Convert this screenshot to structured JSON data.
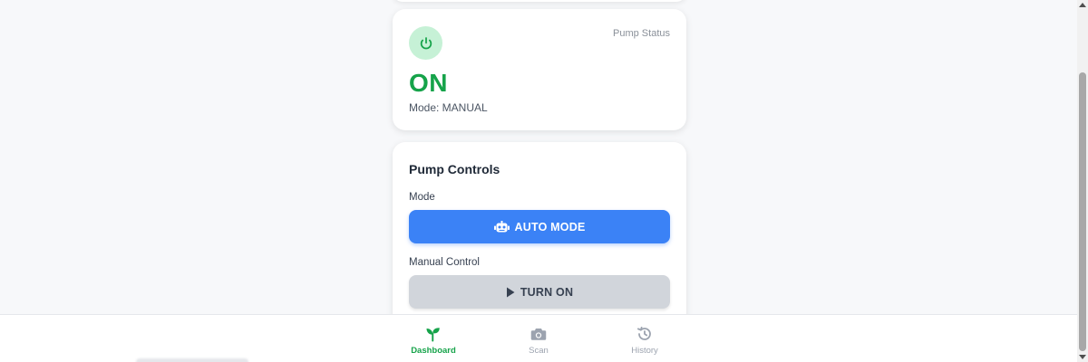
{
  "status_card": {
    "label": "Pump Status",
    "value": "ON",
    "mode_text": "Mode: MANUAL",
    "icon": "power-icon"
  },
  "controls": {
    "title": "Pump Controls",
    "mode_label": "Mode",
    "auto_mode_button": "AUTO MODE",
    "auto_mode_icon": "robot-icon",
    "manual_label": "Manual Control",
    "turn_on_button": "TURN ON",
    "turn_on_icon": "play-icon"
  },
  "bottom_nav": {
    "items": [
      {
        "label": "Dashboard",
        "icon": "seedling-icon",
        "active": true
      },
      {
        "label": "Scan",
        "icon": "camera-icon",
        "active": false
      },
      {
        "label": "History",
        "icon": "history-icon",
        "active": false
      }
    ]
  },
  "colors": {
    "accent_green": "#16a34a",
    "primary_blue": "#3b82f6",
    "disabled_gray": "#d1d5db"
  }
}
